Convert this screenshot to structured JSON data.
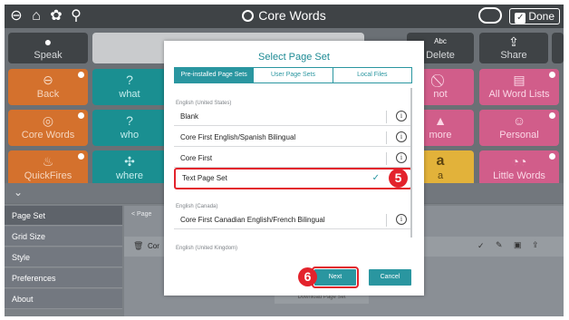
{
  "topbar": {
    "title": "Core Words",
    "done_label": "Done"
  },
  "toolbar": {
    "speak_label": "Speak",
    "delete_label": "Delete",
    "delete_badge": "Abc",
    "share_label": "Share"
  },
  "tiles": [
    {
      "label": "Back",
      "color": "orange"
    },
    {
      "label": "what",
      "color": "teal"
    },
    {
      "label": "not",
      "color": "pink"
    },
    {
      "label": "All Word Lists",
      "color": "pink"
    },
    {
      "label": "Core Words",
      "color": "orange"
    },
    {
      "label": "who",
      "color": "teal"
    },
    {
      "label": "more",
      "color": "pink"
    },
    {
      "label": "Personal",
      "color": "pink"
    },
    {
      "label": "QuickFires",
      "color": "orange"
    },
    {
      "label": "where",
      "color": "teal"
    },
    {
      "label": "a",
      "color": "yellow"
    },
    {
      "label": "Little Words",
      "color": "pink"
    }
  ],
  "sidebar": {
    "items": [
      {
        "label": "Page Set"
      },
      {
        "label": "Grid Size"
      },
      {
        "label": "Style"
      },
      {
        "label": "Preferences"
      },
      {
        "label": "About"
      }
    ]
  },
  "background_pane": {
    "breadcrumb": "Page",
    "row_label": "Cor",
    "download_label": "Download Page Set"
  },
  "modal": {
    "title": "Select Page Set",
    "tabs": [
      {
        "label": "Pre-installed Page Sets",
        "active": true
      },
      {
        "label": "User Page Sets",
        "active": false
      },
      {
        "label": "Local Files",
        "active": false
      }
    ],
    "groups": [
      {
        "label": "English (United States)",
        "items": [
          {
            "label": "Blank"
          },
          {
            "label": "Core First English/Spanish Bilingual"
          },
          {
            "label": "Core First"
          },
          {
            "label": "Text Page Set",
            "selected": true
          }
        ]
      },
      {
        "label": "English (Canada)",
        "items": [
          {
            "label": "Core First Canadian English/French Bilingual"
          }
        ]
      },
      {
        "label": "English (United Kingdom)",
        "items": []
      }
    ],
    "next_label": "Next",
    "cancel_label": "Cancel"
  },
  "callouts": {
    "step_5": "5",
    "step_6": "6"
  },
  "colors": {
    "accent": "#2a96a0",
    "highlight": "#e3232c"
  }
}
